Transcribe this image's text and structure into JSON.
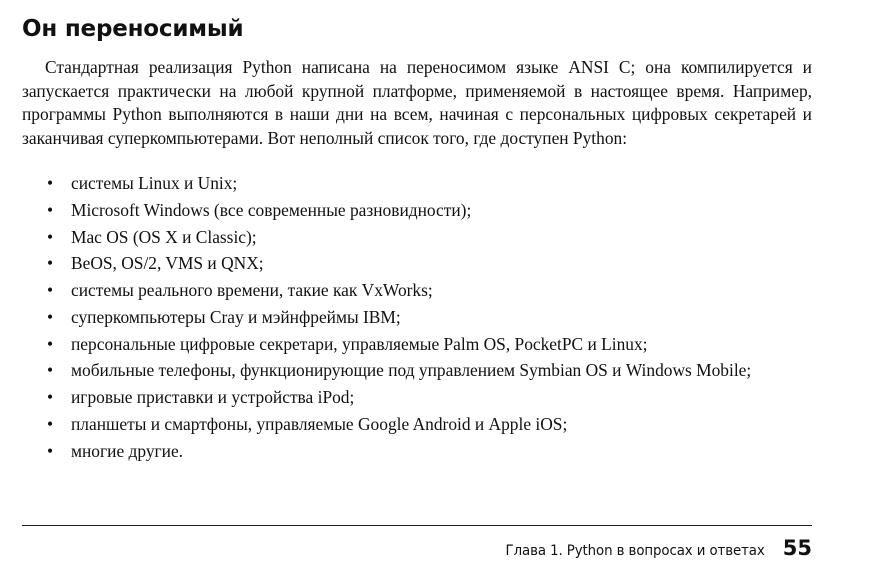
{
  "section": {
    "title": "Он переносимый",
    "paragraph": "Стандартная реализация Python написана на переносимом языке ANSI C; она компилируется и запускается практически на любой крупной платформе, применяемой в настоящее время. Например, программы Python выполняются в наши дни на всем, начиная с персональных цифровых секретарей и заканчивая суперкомпьютерами. Вот неполный список того, где доступен Python:",
    "items": [
      "системы Linux и Unix;",
      "Microsoft Windows (все современные разновидности);",
      "Mac OS (OS X и Classic);",
      "BeOS, OS/2, VMS и QNX;",
      "системы реального времени, такие как VxWorks;",
      "суперкомпьютеры Cray и мэйнфреймы IBM;",
      "персональные цифровые секретари, управляемые Palm OS, PocketPC и Linux;",
      "мобильные телефоны, функционирующие под управлением Symbian OS и Windows Mobile;",
      "игровые приставки и устройства iPod;",
      "планшеты и смартфоны, управляемые Google Android и Apple iOS;",
      "многие другие."
    ],
    "bullet_glyph": "•"
  },
  "footer": {
    "chapter": "Глава 1. Python в вопросах и ответах",
    "page_number": "55"
  }
}
